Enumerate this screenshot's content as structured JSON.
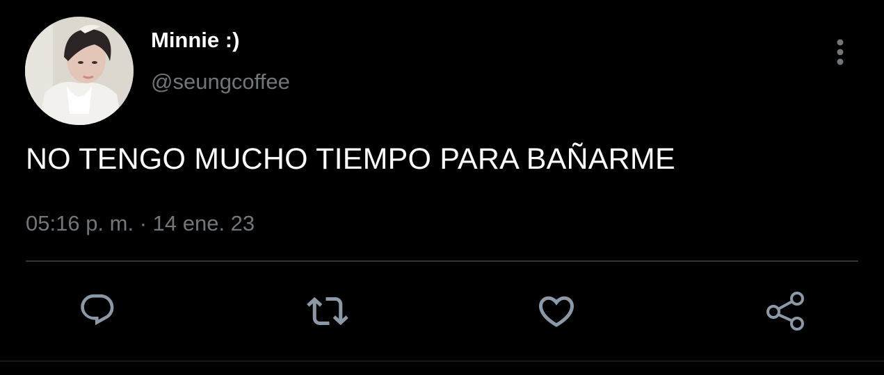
{
  "tweet": {
    "author": {
      "display_name": "Minnie :)",
      "handle": "@seungcoffee"
    },
    "text": "NO TENGO MUCHO TIEMPO PARA BAÑARME",
    "timestamp": "05:16 p. m. · 14 ene. 23"
  },
  "actions": [
    {
      "icon": "reply-icon"
    },
    {
      "icon": "retweet-icon"
    },
    {
      "icon": "like-icon"
    },
    {
      "icon": "share-icon"
    }
  ],
  "colors": {
    "background": "#000000",
    "text_primary": "#ffffff",
    "text_secondary": "#71767b",
    "divider": "#2f3336",
    "icon": "#8b98a5"
  }
}
